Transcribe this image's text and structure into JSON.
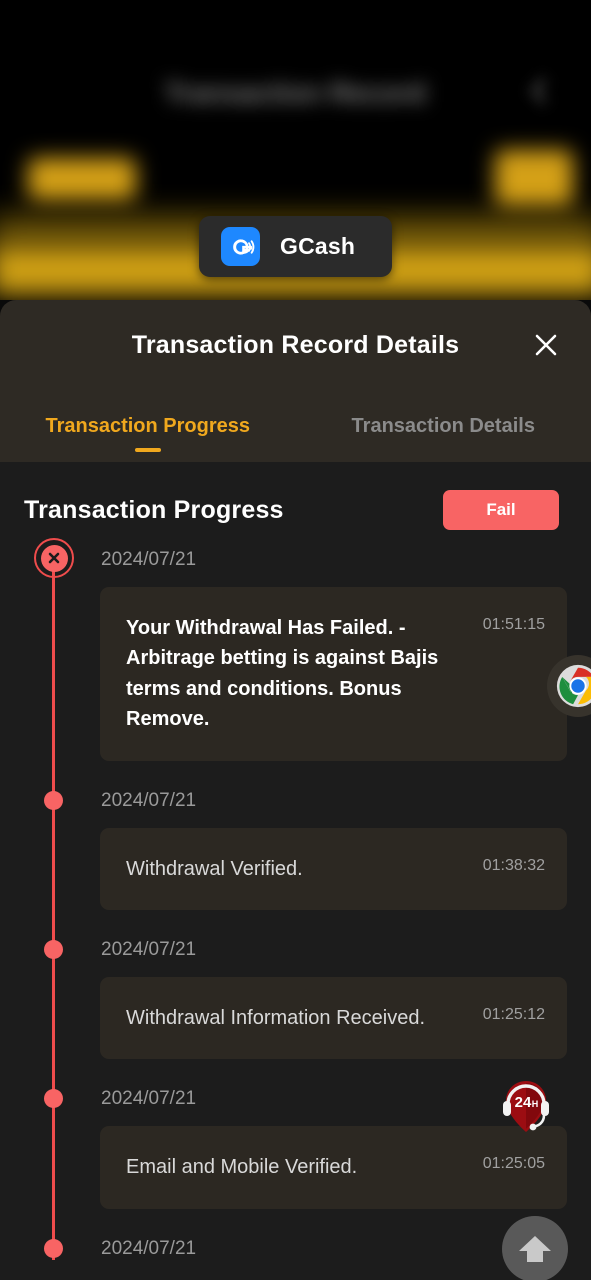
{
  "background": {
    "page_title": "Transaction Record",
    "back_icon": "back-chevron-icon"
  },
  "payment_chip": {
    "name": "GCash",
    "logo_icon": "gcash-logo-icon"
  },
  "modal": {
    "title": "Transaction Record Details",
    "close_icon": "close-icon",
    "tabs": [
      {
        "label": "Transaction Progress",
        "active": true
      },
      {
        "label": "Transaction Details",
        "active": false
      }
    ]
  },
  "progress": {
    "heading": "Transaction Progress",
    "status": "Fail",
    "status_color": "#f86464",
    "accent_color": "#f0a81e",
    "rail_color": "#ef4c4c",
    "events": [
      {
        "date": "2024/07/21",
        "text": "Your Withdrawal Has Failed. - Arbitrage betting is against Bajis terms and conditions. Bonus Remove.",
        "time": "01:51:15",
        "marker": "error-x-icon",
        "emphasis": true
      },
      {
        "date": "2024/07/21",
        "text": "Withdrawal Verified.",
        "time": "01:38:32",
        "marker": "dot",
        "emphasis": false
      },
      {
        "date": "2024/07/21",
        "text": "Withdrawal Information Received.",
        "time": "01:25:12",
        "marker": "dot",
        "emphasis": false
      },
      {
        "date": "2024/07/21",
        "text": "Email and Mobile Verified.",
        "time": "01:25:05",
        "marker": "dot",
        "emphasis": false
      },
      {
        "date": "2024/07/21",
        "text": "",
        "time": "",
        "marker": "dot",
        "emphasis": false
      }
    ]
  },
  "floating": {
    "chrome_icon": "chrome-browser-icon",
    "support_label": "24",
    "support_unit": "H",
    "support_icon": "headset-support-icon",
    "scroll_top_icon": "arrow-up-icon"
  }
}
